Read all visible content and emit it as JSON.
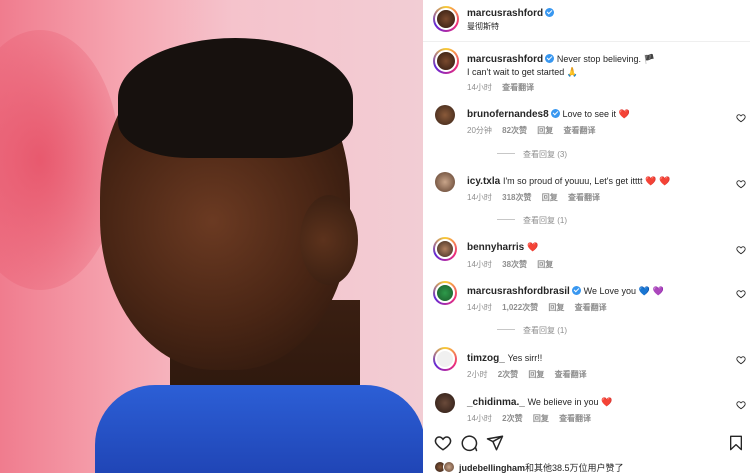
{
  "post": {
    "author": "marcusrashford",
    "location": "曼彻斯特",
    "caption_line1": "Never stop believing. 🏴",
    "caption_line2": "I can't wait to get started 🙏",
    "caption_time": "14小时",
    "see_translation": "查看翻译"
  },
  "comments": [
    {
      "user": "brunofernandes8",
      "verified": true,
      "text": "Love to see it",
      "emoji": "❤️",
      "time": "20分钟",
      "likes": "82次赞",
      "reply": "回复",
      "translate": "查看翻译",
      "view_replies": "查看回复 (3)"
    },
    {
      "user": "icy.txla",
      "verified": false,
      "text": "I'm so proud of youuu, Let's get itttt",
      "emoji": "❤️ ❤️",
      "time": "14小时",
      "likes": "318次赞",
      "reply": "回复",
      "translate": "查看翻译",
      "view_replies": "查看回复 (1)"
    },
    {
      "user": "bennyharris",
      "verified": false,
      "text": "",
      "emoji": "❤️",
      "time": "14小时",
      "likes": "38次赞",
      "reply": "回复",
      "translate": "",
      "view_replies": ""
    },
    {
      "user": "marcusrashfordbrasil",
      "verified": true,
      "text": "We Love you",
      "emoji": "💙 💜",
      "time": "14小时",
      "likes": "1,022次赞",
      "reply": "回复",
      "translate": "查看翻译",
      "view_replies": "查看回复 (1)"
    },
    {
      "user": "timzog_",
      "verified": false,
      "text": "Yes sirr!!",
      "emoji": "",
      "time": "2小时",
      "likes": "2次赞",
      "reply": "回复",
      "translate": "查看翻译",
      "view_replies": ""
    },
    {
      "user": "_chidinma._",
      "verified": false,
      "text": "We believe in you",
      "emoji": "❤️",
      "time": "14小时",
      "likes": "2次赞",
      "reply": "回复",
      "translate": "查看翻译",
      "view_replies": ""
    }
  ],
  "likes_line": {
    "user": "judebellingham",
    "rest": "和其他38.5万位用户赞了"
  },
  "colors": {
    "verified": "#3897f0",
    "heart": "#ed2e3c",
    "meta": "#8e8e8e"
  }
}
